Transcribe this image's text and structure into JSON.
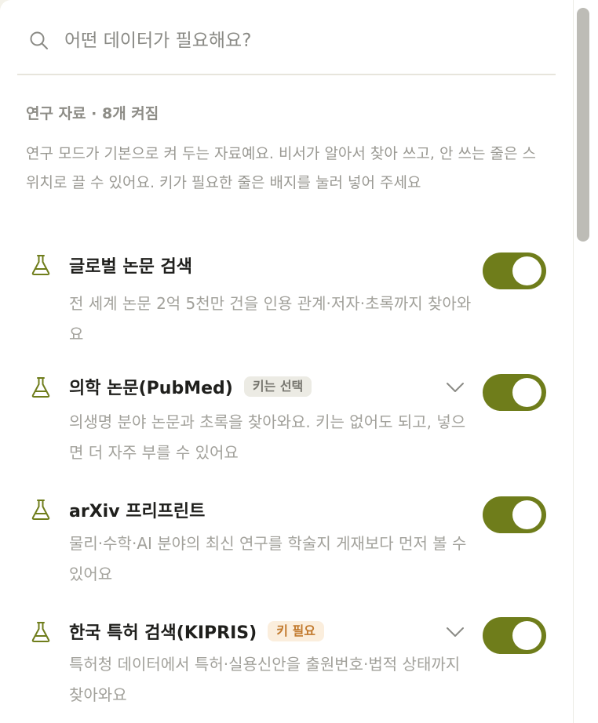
{
  "search": {
    "placeholder": "어떤 데이터가 필요해요?",
    "icon": "search-icon"
  },
  "section": {
    "title": "연구 자료 · 8개 켜짐",
    "description": "연구 모드가 기본으로 켜 두는 자료예요. 비서가 알아서 찾아 쓰고, 안 쓰는 줄은 스위치로 끌 수 있어요. 키가 필요한 줄은 배지를 눌러 넣어 주세요"
  },
  "items": [
    {
      "title": "글로벌 논문 검색",
      "badge": null,
      "description": "전 세계 논문 2억 5천만 건을 인용 관계·저자·초록까지 찾아와요",
      "enabled": true,
      "expandable": false,
      "icon": "flask-icon"
    },
    {
      "title": "의학 논문(PubMed)",
      "badge": "키는 선택",
      "description": "의생명 분야 논문과 초록을 찾아와요. 키는 없어도 되고, 넣으면 더 자주 부를 수 있어요",
      "enabled": true,
      "expandable": true,
      "icon": "flask-icon"
    },
    {
      "title": "arXiv 프리프린트",
      "badge": null,
      "description": "물리·수학·AI 분야의 최신 연구를 학술지 게재보다 먼저 볼 수 있어요",
      "enabled": true,
      "expandable": false,
      "icon": "flask-icon"
    },
    {
      "title": "한국 특허 검색(KIPRIS)",
      "badge": "키 필요",
      "description": "특허청 데이터에서 특허·실용신안을 출원번호·법적 상태까지 찾아와요",
      "enabled": true,
      "expandable": true,
      "icon": "flask-icon"
    }
  ],
  "colors": {
    "toggle_on": "#6f7d1b",
    "flask_icon": "#6f7d1b",
    "badge_required_text": "#c27a2e",
    "badge_required_bg": "#fbeedd",
    "badge_optional_bg": "#ecebe4"
  }
}
